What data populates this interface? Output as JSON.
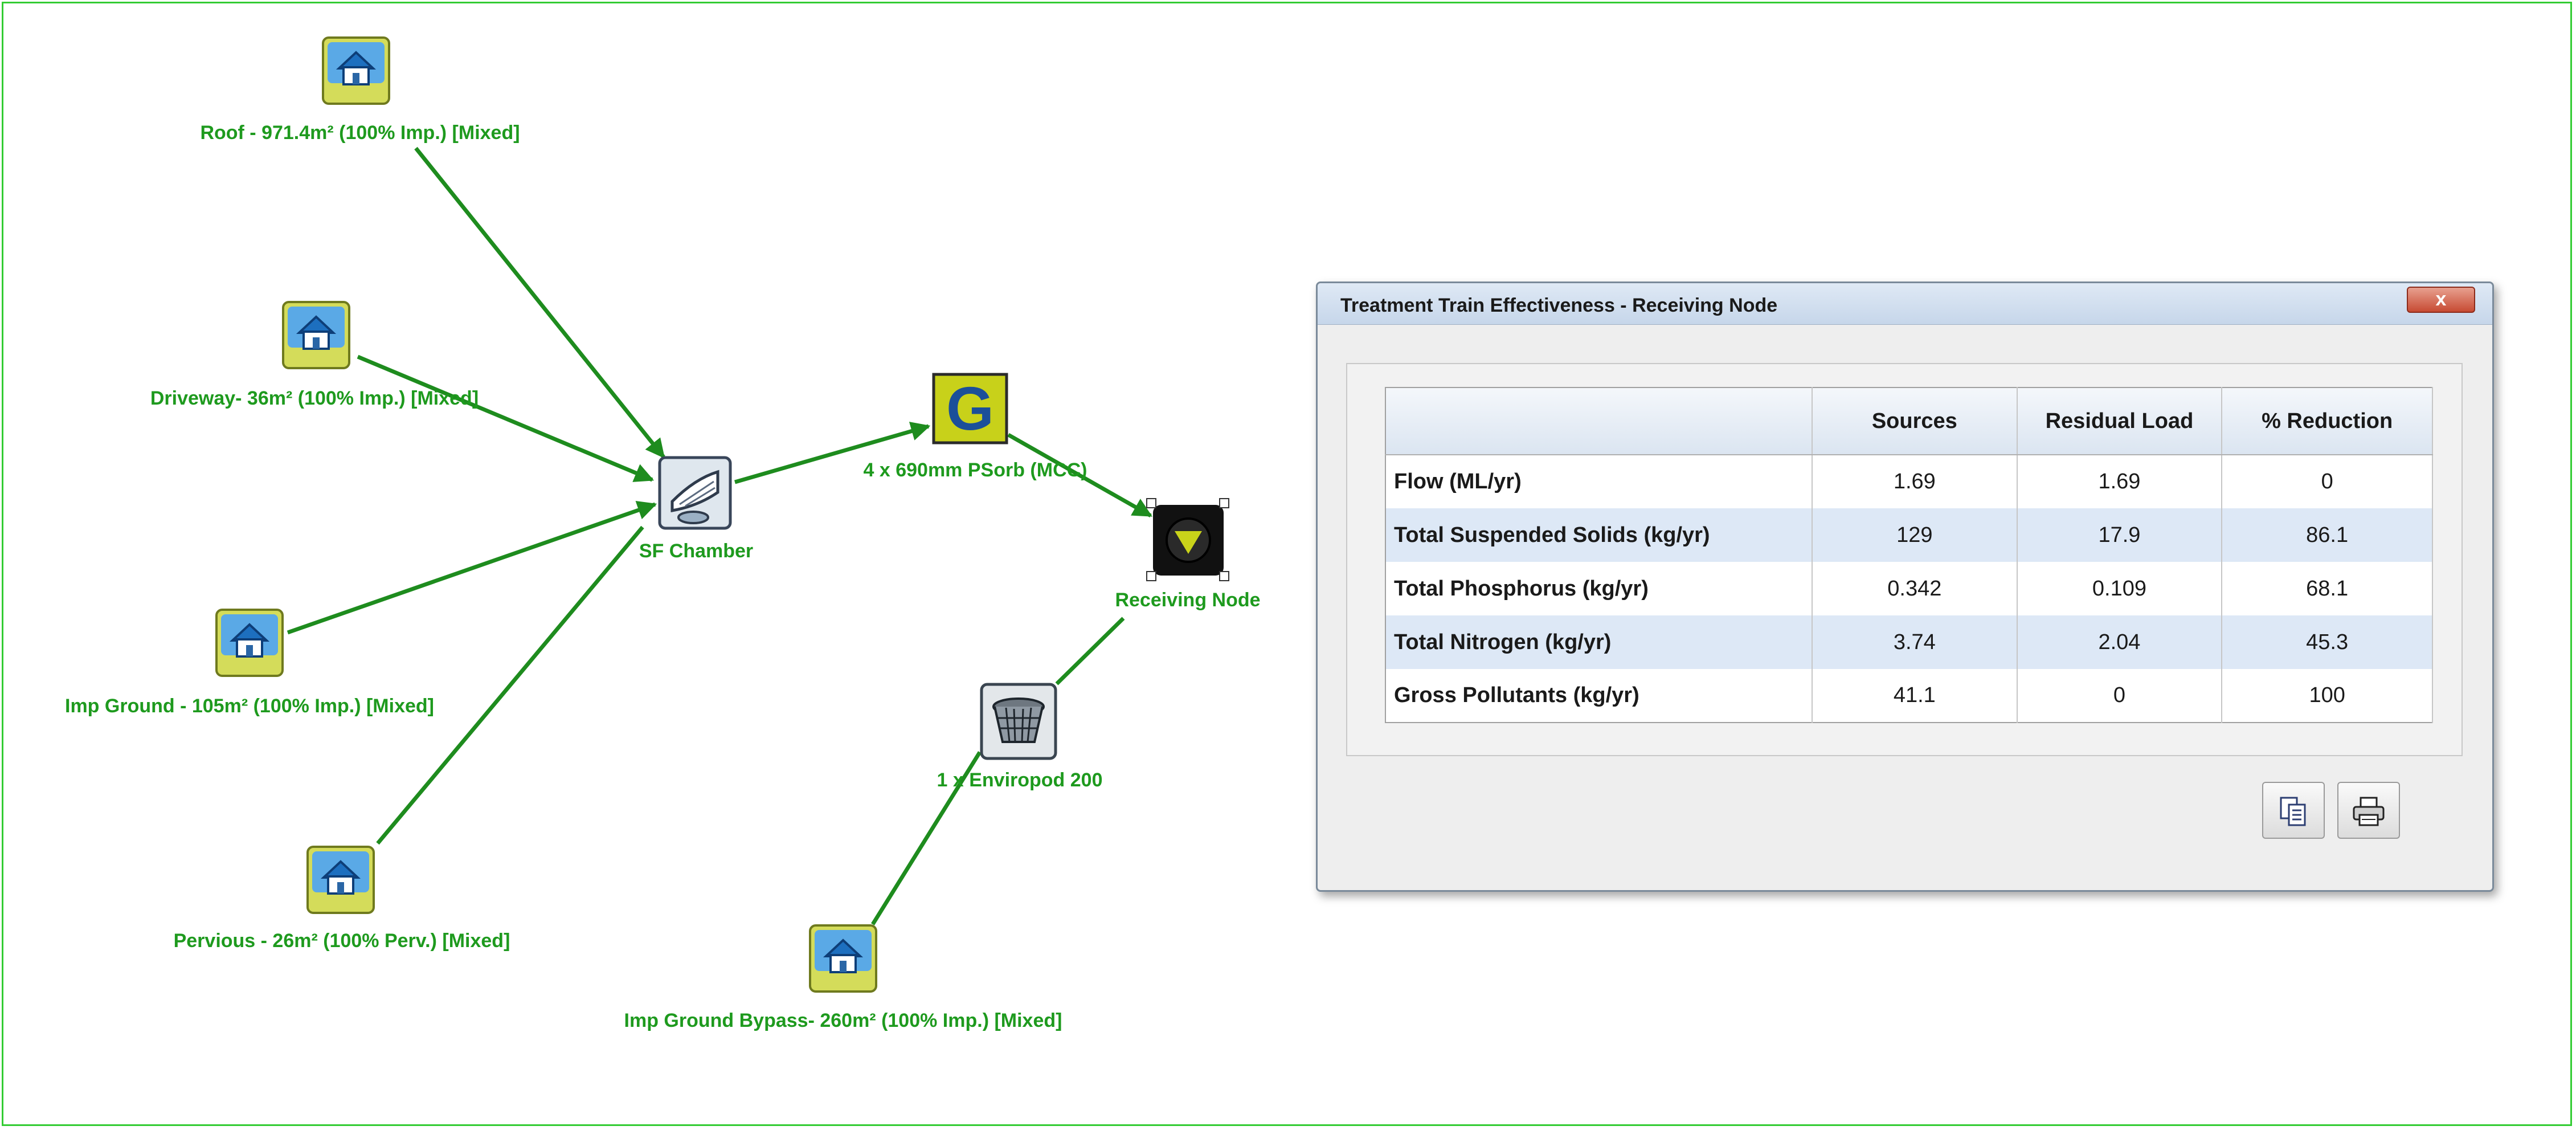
{
  "diagram": {
    "nodes": {
      "roof": {
        "label": "Roof - 971.4m² (100% Imp.) [Mixed]",
        "icon": "house-icon"
      },
      "driveway": {
        "label": "Driveway- 36m² (100% Imp.) [Mixed]",
        "icon": "house-icon"
      },
      "imp_ground": {
        "label": "Imp Ground - 105m² (100% Imp.) [Mixed]",
        "icon": "house-icon"
      },
      "pervious": {
        "label": "Pervious - 26m² (100% Perv.) [Mixed]",
        "icon": "house-icon"
      },
      "imp_ground_bypass": {
        "label": "Imp Ground Bypass- 260m² (100% Imp.) [Mixed]",
        "icon": "house-icon"
      },
      "sf_chamber": {
        "label": "SF Chamber",
        "icon": "sediment-chamber-icon"
      },
      "psorb": {
        "label": "4 x 690mm PSorb (MCC)",
        "icon": "filter-g-icon"
      },
      "receiving_node": {
        "label": "Receiving Node",
        "icon": "receiving-node-icon"
      },
      "enviropod": {
        "label": "1 x Enviropod 200",
        "icon": "pit-basket-icon"
      }
    },
    "link_color": "#1e8c1e"
  },
  "dialog": {
    "title": "Treatment Train Effectiveness - Receiving Node",
    "close_label": "x",
    "table": {
      "headers": [
        "",
        "Sources",
        "Residual Load",
        "% Reduction"
      ],
      "rows": [
        {
          "label": "Flow (ML/yr)",
          "sources": "1.69",
          "residual": "1.69",
          "reduction": "0"
        },
        {
          "label": "Total Suspended Solids (kg/yr)",
          "sources": "129",
          "residual": "17.9",
          "reduction": "86.1"
        },
        {
          "label": "Total Phosphorus (kg/yr)",
          "sources": "0.342",
          "residual": "0.109",
          "reduction": "68.1"
        },
        {
          "label": "Total Nitrogen (kg/yr)",
          "sources": "3.74",
          "residual": "2.04",
          "reduction": "45.3"
        },
        {
          "label": "Gross Pollutants (kg/yr)",
          "sources": "41.1",
          "residual": "0",
          "reduction": "100"
        }
      ]
    },
    "buttons": {
      "copy": "copy-icon",
      "print": "printer-icon"
    }
  }
}
